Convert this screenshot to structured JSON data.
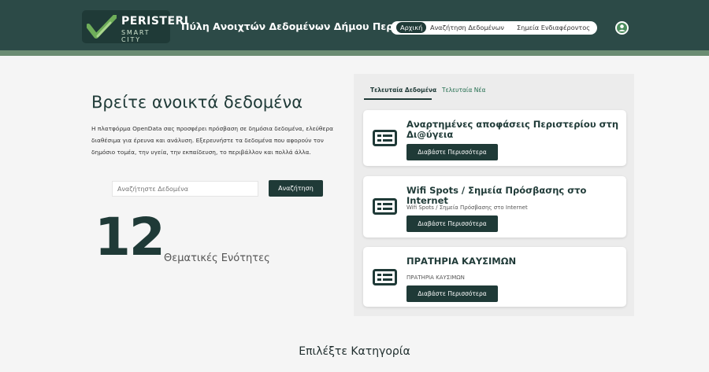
{
  "header": {
    "logo": {
      "brand": "PERISTERI",
      "sub": "SMART CITY"
    },
    "site_title": "Πύλη Ανοιχτών Δεδομένων Δήμου Περιστερίου",
    "nav": [
      {
        "label": "Αρχική",
        "active": true
      },
      {
        "label": "Αναζήτηση Δεδομένων",
        "active": false
      },
      {
        "label": "Σημεία Ενδιαφέροντος",
        "active": false
      }
    ],
    "avatar_icon": "user-avatar-icon",
    "colors": {
      "primary": "#1f3a37",
      "header": "#2c4a47",
      "stripe": "#6b8c73"
    }
  },
  "hero": {
    "title": "Βρείτε ανοικτά δεδομένα",
    "description": "Η πλατφόρμα OpenData σας προσφέρει πρόσβαση σε δημόσια δεδομένα, ελεύθερα διαθέσιμα για έρευνα και ανάλυση. Εξερευνήστε τα δεδομένα που αφορούν τον δημόσιο τομέα, την υγεία, την εκπαίδευση, το περιβάλλον και πολλά άλλα.",
    "search": {
      "placeholder": "Αναζήτηστε Δεδομένα",
      "value": "",
      "button": "Αναζήτηση"
    },
    "count": "12",
    "count_label": "Θεματικές Ενότητες"
  },
  "panel": {
    "tabs": [
      {
        "label": "Τελευταία Δεδομένα",
        "active": true
      },
      {
        "label": "Τελευταία Νέα",
        "active": false
      }
    ],
    "cards": [
      {
        "title": "Αναρτημένες αποφάσεις Περιστερίου στη Δι@ύγεια",
        "subtitle": "",
        "button": "Διαβάστε Περισσότερα",
        "icon": "newspaper-icon"
      },
      {
        "title": "Wifi Spots / Σημεία Πρόσβασης στο Internet",
        "subtitle": "Wifi Spots / Σημεία Πρόσβασης στο Internet",
        "button": "Διαβάστε Περισσότερα",
        "icon": "newspaper-icon"
      },
      {
        "title": "ΠΡΑΤΗΡΙΑ ΚΑΥΣΙΜΩΝ",
        "subtitle": "ΠΡΑΤΗΡΙΑ ΚΑΥΣΙΜΩΝ",
        "button": "Διαβάστε Περισσότερα",
        "icon": "newspaper-icon"
      }
    ]
  },
  "categories": {
    "title": "Επιλέξτε Κατηγορία"
  }
}
